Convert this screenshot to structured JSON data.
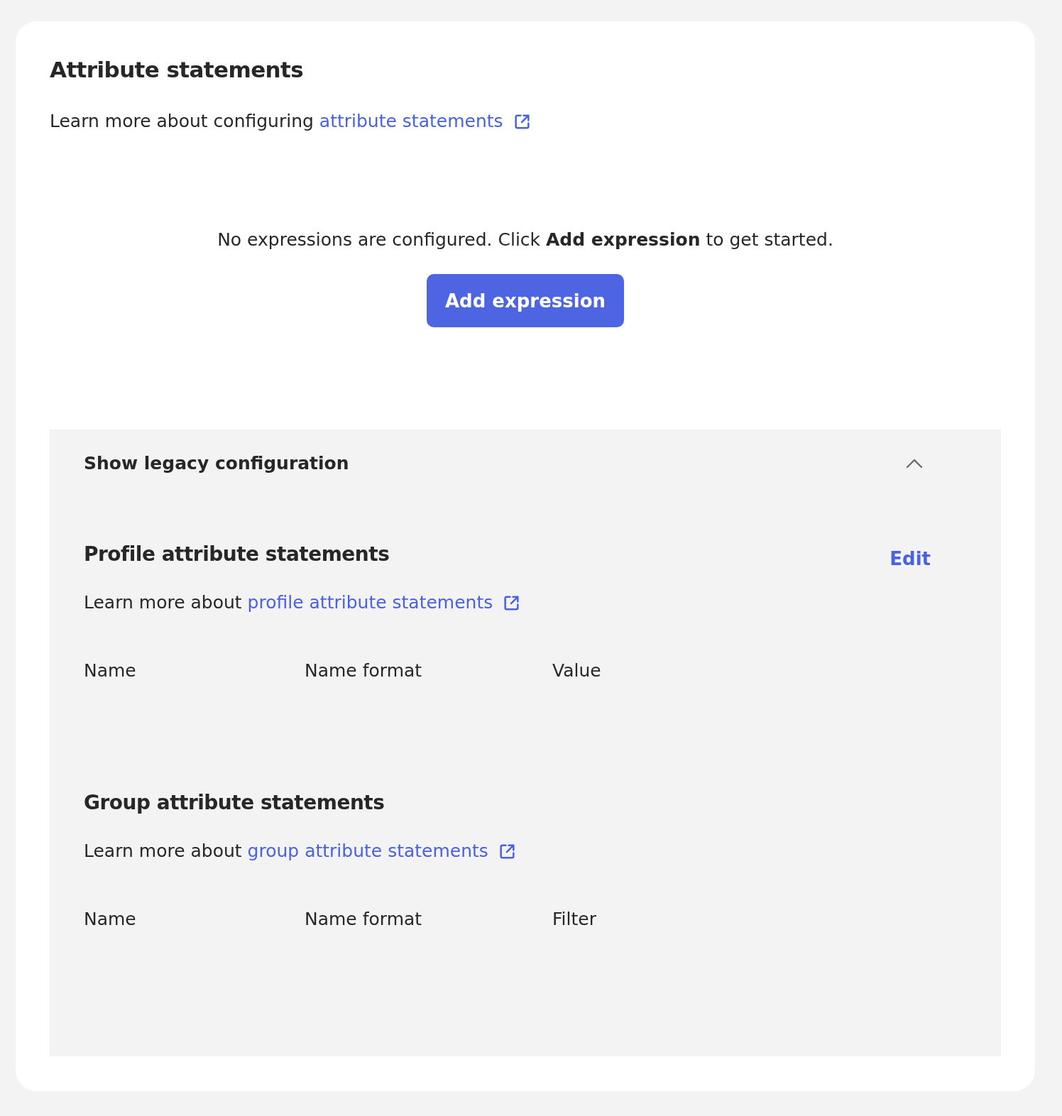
{
  "section": {
    "title": "Attribute statements",
    "text": "Learn more about configuring",
    "link": "attribute statements"
  },
  "empty_state": {
    "message": "No expressions are configured. Click **Add expression** to get started.",
    "button": "Add expression"
  },
  "legacy": {
    "toggle": "Show legacy configuration",
    "expanded": true,
    "groups": [
      {
        "title": "Profile attribute statements",
        "action": "Edit",
        "text": "Learn more about",
        "link": "profile attribute statements",
        "columns": [
          "Name",
          "Name format",
          "Value"
        ]
      },
      {
        "title": "Group attribute statements",
        "text": "Learn more about",
        "link": "group attribute statements",
        "columns": [
          "Name",
          "Name format",
          "Filter"
        ]
      }
    ]
  }
}
